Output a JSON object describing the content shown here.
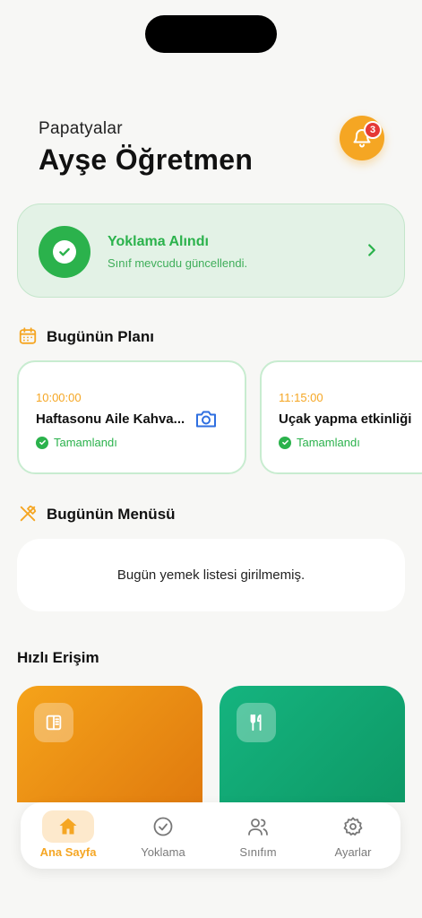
{
  "header": {
    "school_name": "Papatyalar",
    "teacher_name": "Ayşe Öğretmen",
    "notification_count": "3"
  },
  "attendance": {
    "title": "Yoklama Alındı",
    "subtitle": "Sınıf mevcudu güncellendi."
  },
  "plan": {
    "title": "Bugünün Planı",
    "items": [
      {
        "time": "10:00:00",
        "name": "Haftasonu Aile Kahva...",
        "status": "Tamamlandı"
      },
      {
        "time": "11:15:00",
        "name": "Uçak yapma etkinliği",
        "status": "Tamamlandı"
      }
    ]
  },
  "menu": {
    "title": "Bugünün Menüsü",
    "empty_text": "Bugün yemek listesi girilmemiş."
  },
  "quick_access": {
    "title": "Hızlı Erişim",
    "items": [
      {
        "icon": "book-icon",
        "color": "#f5a31a"
      },
      {
        "icon": "cutlery-icon",
        "color": "#15b47f"
      }
    ]
  },
  "tabs": [
    {
      "label": "Ana Sayfa",
      "icon": "home-icon",
      "active": true
    },
    {
      "label": "Yoklama",
      "icon": "check-circle-icon",
      "active": false
    },
    {
      "label": "Sınıfım",
      "icon": "users-icon",
      "active": false
    },
    {
      "label": "Ayarlar",
      "icon": "gear-icon",
      "active": false
    }
  ],
  "colors": {
    "accent": "#f5a623",
    "success": "#2bb24c",
    "background": "#f7f7f5"
  }
}
